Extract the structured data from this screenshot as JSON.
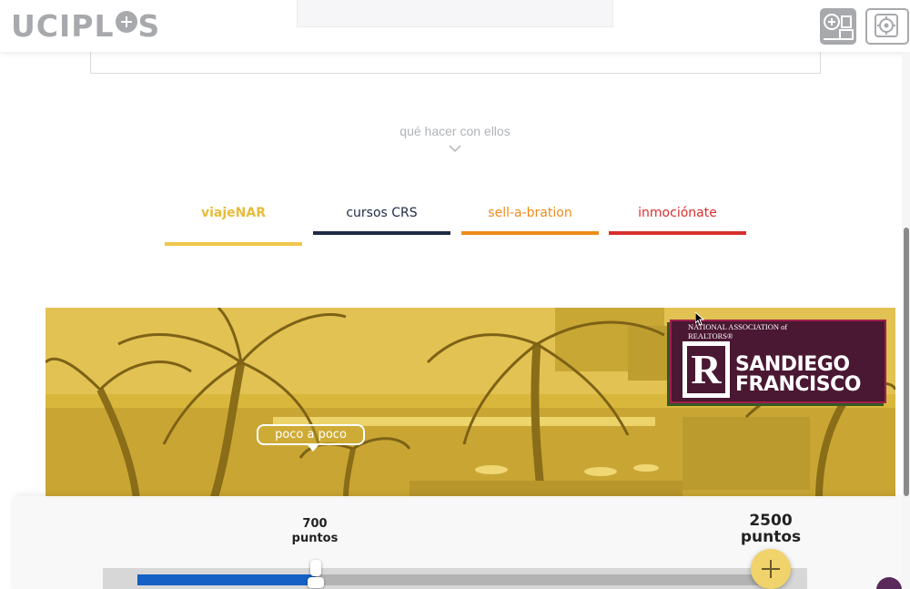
{
  "header": {
    "logo_text_left": "UCIPL",
    "logo_text_right": "S",
    "add_button_icon": "add-window-icon",
    "settings_button_icon": "gear-icon"
  },
  "section": {
    "label": "qué hacer con ellos",
    "chevron_icon": "chevron-down-icon"
  },
  "tabs": [
    {
      "label": "viajeNAR",
      "color": "#e7bb3c",
      "active": true
    },
    {
      "label": "cursos CRS",
      "color": "#1f2b45",
      "active": false
    },
    {
      "label": "sell-a-bration",
      "color": "#ef8b1c",
      "active": false
    },
    {
      "label": "inmociónate",
      "color": "#d82f2c",
      "active": false
    }
  ],
  "hero": {
    "badge_small_text": "NATIONAL ASSOCIATION of REALTORS®",
    "badge_line1": "SANDIEGO",
    "badge_line2": "FRANCISCO",
    "badge_r": "R",
    "tooltip": "poco a poco"
  },
  "points": {
    "current_value": "700",
    "current_unit": "puntos",
    "max_value": "2500",
    "max_unit": "puntos",
    "progress_fraction": 0.28,
    "add_icon": "plus-icon"
  },
  "colors": {
    "logo_gray": "#a7a9ac",
    "hero_tint": "#d8b53a",
    "badge_bg": "#4a1832",
    "progress_blue": "#1460c4"
  }
}
